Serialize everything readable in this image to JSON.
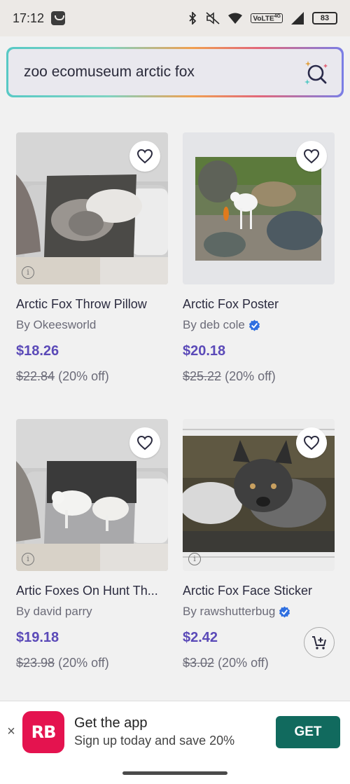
{
  "status": {
    "time": "17:12",
    "network": "VoLTE",
    "net_gen": "4G",
    "battery": "83"
  },
  "search": {
    "query": "zoo ecomuseum arctic fox"
  },
  "products": [
    {
      "title": "Arctic Fox Throw Pillow",
      "by": "By Okeesworld",
      "verified": false,
      "price": "$18.26",
      "orig_price": "$22.84",
      "discount": "(20% off)"
    },
    {
      "title": "Arctic Fox Poster",
      "by": "By deb cole",
      "verified": true,
      "price": "$20.18",
      "orig_price": "$25.22",
      "discount": "(20% off)"
    },
    {
      "title": "Artic Foxes On Hunt Th...",
      "by": "By david parry",
      "verified": false,
      "price": "$19.18",
      "orig_price": "$23.98",
      "discount": "(20% off)"
    },
    {
      "title": "Arctic Fox Face Sticker",
      "by": "By rawshutterbug",
      "verified": true,
      "price": "$2.42",
      "orig_price": "$3.02",
      "discount": "(20% off)"
    }
  ],
  "banner": {
    "close": "×",
    "logo": "RB",
    "title": "Get the app",
    "subtitle": "Sign up today and save 20%",
    "cta": "GET"
  },
  "colors": {
    "price": "#5b4ab8",
    "cta": "#116a5e",
    "brand": "#e4134f",
    "verified": "#2f6fe0"
  },
  "icons": [
    "heart-outline-icon",
    "info-icon",
    "verified-badge-icon",
    "add-to-cart-icon",
    "ai-search-icon",
    "bluetooth-icon",
    "mute-icon",
    "wifi-icon",
    "signal-icon"
  ]
}
